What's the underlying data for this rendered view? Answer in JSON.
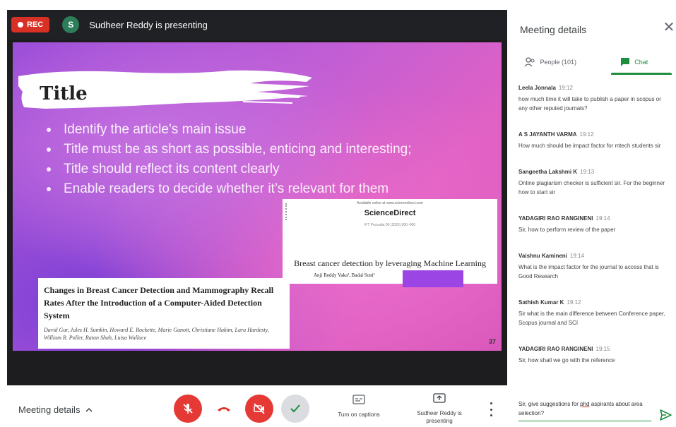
{
  "top_bar": {
    "rec_label": "REC",
    "presenter_initial": "S",
    "presenting_text": "Sudheer Reddy is presenting"
  },
  "slide": {
    "title": "Title",
    "bullets": [
      "Identify the article’s main issue",
      "Title must be as short as possible, enticing and interesting;",
      "Title should reflect its content clearly",
      "Enable readers to decide whether it’s relevant for them"
    ],
    "paper_right": {
      "available_line": "Available online at www.sciencedirect.com",
      "publisher": "ScienceDirect",
      "sub_line": "IFT Procedia 00 (2020) 000–000",
      "title": "Breast cancer detection by leveraging Machine Learning",
      "authors": "Anji Reddy Vaka¹, Badal Soni¹"
    },
    "paper_left": {
      "title": "Changes in Breast Cancer Detection and Mammography Recall Rates After the Introduction of a Computer-Aided Detection System",
      "authors": "David Gur, Jules H. Sumkin, Howard E. Rockette, Marie Ganott, Christiane Hakim, Lara Hardesty, William R. Poller, Ratan Shah, Luisa Wallace"
    },
    "slide_number": "37"
  },
  "panel": {
    "title": "Meeting details",
    "tabs": {
      "people": "People (101)",
      "chat": "Chat"
    },
    "messages": [
      {
        "sender": "Leela Jonnala",
        "time": "19:12",
        "text": "how much time it will take to publish a paper in scopus or any other reputed journals?"
      },
      {
        "sender": "A S JAYANTH VARMA",
        "time": "19:12",
        "text": "How much should be impact factor for mtech students sir"
      },
      {
        "sender": "Sangeetha Lakshmi K",
        "time": "19:13",
        "text": "Online plagiarism checker is sufficient sir. For the beginner how to start sir"
      },
      {
        "sender": "YADAGIRI RAO RANGINENI",
        "time": "19:14",
        "text": "Sir, how to perform review of the paper"
      },
      {
        "sender": "Vaishnu Kamineni",
        "time": "19:14",
        "text": "What is the impact factor for the journal to access that is Good Research"
      },
      {
        "sender": "Sathish Kumar K",
        "time": "19:12",
        "text": "Sir what is the main difference between Conference paper, Scopus journal and SCI"
      },
      {
        "sender": "YADAGIRI RAO RANGINENI",
        "time": "19:15",
        "text": "Sir, how shall we go with the reference"
      }
    ],
    "input_pre": "Sir, give suggestions for ",
    "input_underlined": "phd",
    "input_post": " aspirants about area selection?"
  },
  "bottom_bar": {
    "details_label": "Meeting details",
    "captions_label": "Turn on captions",
    "presenting_label": "Sudheer Reddy is presenting"
  },
  "colors": {
    "rec": "#d93025",
    "danger": "#e53935",
    "chat_accent": "#1e8e3e",
    "panel_text": "#3c4043"
  }
}
